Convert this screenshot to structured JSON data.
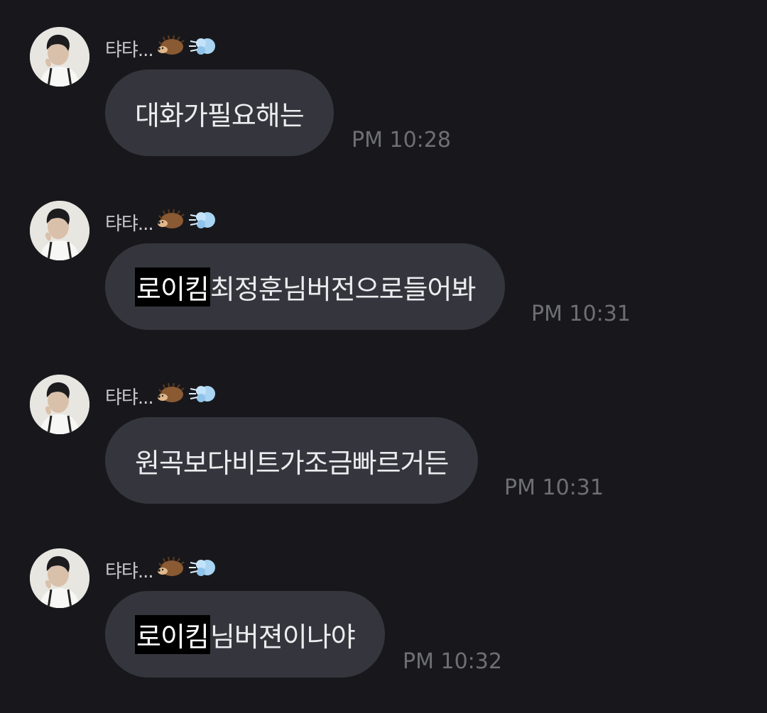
{
  "messages": [
    {
      "sender": "탸탸...",
      "text_highlight": "",
      "text": "대화가필요해는",
      "time": "PM 10:28"
    },
    {
      "sender": "탸탸...",
      "text_highlight": "로이킴",
      "text": "최정훈님버전으로들어봐",
      "time": "PM 10:31"
    },
    {
      "sender": "탸탸...",
      "text_highlight": "",
      "text": "원곡보다비트가조금빠르거든",
      "time": "PM 10:31"
    },
    {
      "sender": "탸탸...",
      "text_highlight": "로이킴",
      "text": "님버젼이나야",
      "time": "PM 10:32"
    }
  ],
  "sender_emojis": [
    "hedgehog-icon",
    "dash-cloud-icon"
  ],
  "colors": {
    "background": "#18181c",
    "bubble": "#35363d",
    "bubble_text": "#ececef",
    "sender_text": "#c9c9cc",
    "time_text": "#6e6f75",
    "highlight": "#000000"
  }
}
